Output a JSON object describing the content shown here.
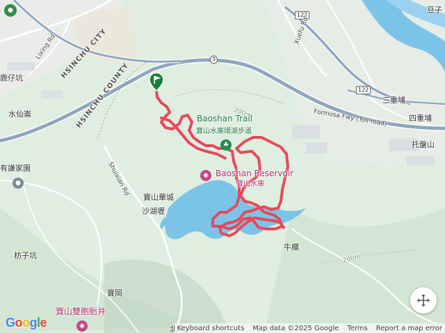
{
  "map": {
    "labels": {
      "hsinchu_city": "HSINCHU CITY",
      "hsinchu_county": "HSINCHU COUNTY",
      "liming_rd": "Lixing Rd",
      "xuefu_rd": "Xuefu Rd",
      "shuixian_rd": "Shuixian Rd",
      "lukezi": "鹿仔坑",
      "shuixianlun": "水仙崙",
      "youqianjiayuan": "有謙家園",
      "fangzikeng": "枋子坑",
      "baogang": "寶岡",
      "beikeng": "北坑",
      "baoshan_huacheng": "寶山華城",
      "shahu_bei": "沙湖壢",
      "niulan": "牛欄",
      "sanchongpu": "三重埔",
      "sichongpu": "四重埔",
      "tuopanshan": "托盤山",
      "dougzi": "豆子",
      "formosa_fwy": "Formosa Fwy (Toll road)"
    },
    "shields": {
      "hwy3": "3",
      "hwy122_top": "122",
      "hwy122_mid": "122"
    },
    "pois": {
      "baoshan_trail_en": "Baoshan Trail",
      "baoshan_trail_zh": "寶山水庫環湖步道",
      "reservoir_en": "Baoshan Reservoir",
      "reservoir_zh": "寶山水庫",
      "twin_well": "寶山雙胞胎井"
    },
    "contour_labels": {
      "c1": "200m",
      "c2": "200m"
    },
    "icons": {
      "start": "start-flag-icon",
      "park": "park-icon",
      "camera": "camera-icon",
      "fullscreen": "fullscreen-icon"
    },
    "colors": {
      "route": "#e8485a",
      "water": "#7cc3e8",
      "highway": "#8fa6bd",
      "terrain": "#dfeee0"
    }
  },
  "footer": {
    "logo": "Google",
    "shortcuts": "Keyboard shortcuts",
    "mapdata": "Map data ©2025 Google",
    "terms": "Terms",
    "report": "Report a map error"
  }
}
